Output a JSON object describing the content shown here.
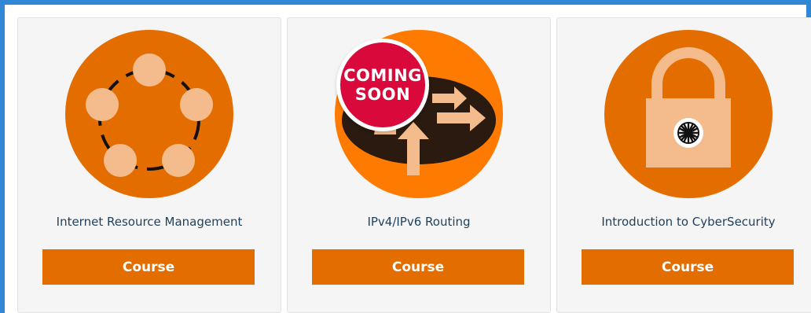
{
  "colors": {
    "accent": "#e46d00",
    "frame": "#2f87d6",
    "badge": "#d90a3b",
    "peach": "#f4bc8c",
    "title_text": "#1f3f5b"
  },
  "courses": [
    {
      "title": "Internet Resource Management",
      "button_label": "Course",
      "icon": "network-nodes-icon"
    },
    {
      "title": "IPv4/IPv6 Routing",
      "button_label": "Course",
      "icon": "routing-arrows-icon",
      "badge": {
        "line1": "COMING",
        "line2": "SOON"
      }
    },
    {
      "title": "Introduction to CyberSecurity",
      "button_label": "Course",
      "icon": "padlock-icon"
    }
  ]
}
